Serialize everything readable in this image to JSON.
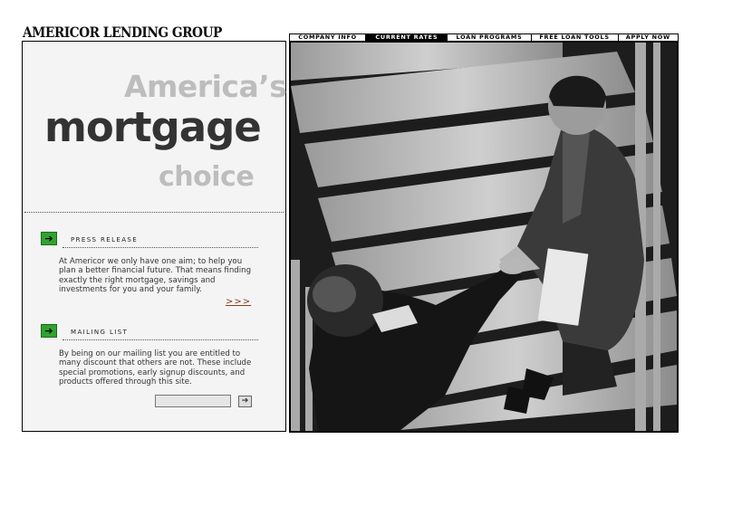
{
  "brand": {
    "logo_text": "AMERICOR LENDING GROUP"
  },
  "nav": {
    "items": [
      {
        "label": "COMPANY INFO",
        "active": false
      },
      {
        "label": "CURRENT RATES",
        "active": true
      },
      {
        "label": "LOAN PROGRAMS",
        "active": false
      },
      {
        "label": "FREE LOAN TOOLS",
        "active": false
      },
      {
        "label": "APPLY NOW",
        "active": false
      }
    ]
  },
  "hero": {
    "line1": "America’s",
    "line2": "mortgage",
    "line3": "choice"
  },
  "press_release": {
    "title": "PRESS RELEASE",
    "body": "At Americor we only have one aim; to help you plan a better financial future. That means finding exactly the right mortgage, savings and investments for you and your family.",
    "more_link": ">>>"
  },
  "mailing_list": {
    "title": "MAILING LIST",
    "body": "By being on our mailing list you are entitled to many discount that others are not. These include special promotions, early signup discounts, and products offered through this site.",
    "email_value": "",
    "email_placeholder": ""
  },
  "icons": {
    "section_arrow": "arrow-right-icon",
    "submit_arrow": "arrow-right-icon"
  },
  "colors": {
    "accent_green": "#2fa32f",
    "link_brown": "#8a3a1f",
    "hero_gray": "#bdbdbd",
    "hero_dark": "#333333"
  }
}
